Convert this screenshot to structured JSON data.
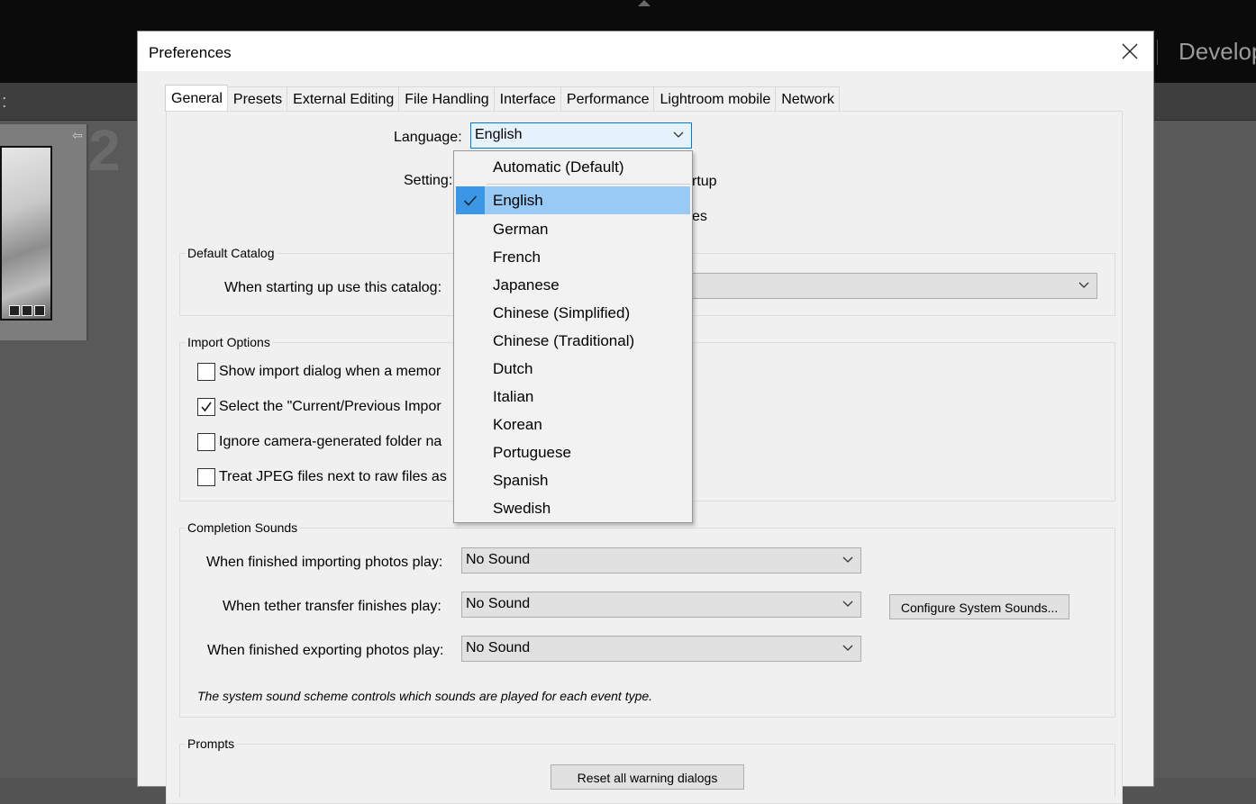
{
  "app": {
    "module_label": "Develop",
    "toolbar_dots": ":",
    "cell_index": "2"
  },
  "dialog": {
    "title": "Preferences",
    "tabs": [
      "General",
      "Presets",
      "External Editing",
      "File Handling",
      "Interface",
      "Performance",
      "Lightroom mobile",
      "Network"
    ],
    "active_tab": "General"
  },
  "general": {
    "language_label": "Language:",
    "language_value": "English",
    "settings_label": "Setting:",
    "settings_tail_1": "rtup",
    "settings_tail_2": "es",
    "default_catalog": {
      "title": "Default Catalog",
      "label": "When starting up use this catalog:",
      "value": ""
    },
    "import_options": {
      "title": "Import Options",
      "items": [
        {
          "label": "Show import dialog when a memor",
          "checked": false
        },
        {
          "label": "Select the \"Current/Previous Impor",
          "checked": true
        },
        {
          "label": "Ignore camera-generated folder na",
          "checked": false
        },
        {
          "label": "Treat JPEG files next to raw files as",
          "checked": false
        }
      ]
    },
    "completion_sounds": {
      "title": "Completion Sounds",
      "rows": [
        {
          "label": "When finished importing photos play:",
          "value": "No Sound"
        },
        {
          "label": "When tether transfer finishes play:",
          "value": "No Sound"
        },
        {
          "label": "When finished exporting photos play:",
          "value": "No Sound"
        }
      ],
      "configure_button": "Configure System Sounds...",
      "note": "The system sound scheme controls which sounds are played for each event type."
    },
    "prompts": {
      "title": "Prompts",
      "reset_button": "Reset all warning dialogs"
    }
  },
  "language_menu": {
    "items": [
      "Automatic (Default)",
      "English",
      "German",
      "French",
      "Japanese",
      "Chinese (Simplified)",
      "Chinese (Traditional)",
      "Dutch",
      "Italian",
      "Korean",
      "Portuguese",
      "Spanish",
      "Swedish"
    ],
    "selected": "English"
  },
  "colors": {
    "selection_bg": "#99c9f5",
    "check_bg": "#3c96e6",
    "focus_border": "#0078d7"
  }
}
